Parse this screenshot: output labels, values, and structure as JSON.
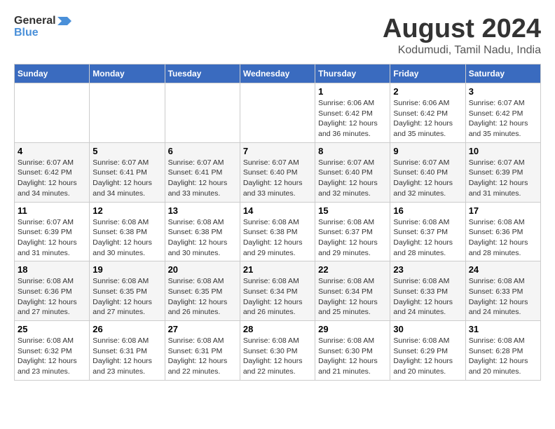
{
  "header": {
    "logo_general": "General",
    "logo_blue": "Blue",
    "title": "August 2024",
    "subtitle": "Kodumudi, Tamil Nadu, India"
  },
  "calendar": {
    "days_of_week": [
      "Sunday",
      "Monday",
      "Tuesday",
      "Wednesday",
      "Thursday",
      "Friday",
      "Saturday"
    ],
    "weeks": [
      [
        {
          "day": "",
          "info": ""
        },
        {
          "day": "",
          "info": ""
        },
        {
          "day": "",
          "info": ""
        },
        {
          "day": "",
          "info": ""
        },
        {
          "day": "1",
          "info": "Sunrise: 6:06 AM\nSunset: 6:42 PM\nDaylight: 12 hours\nand 36 minutes."
        },
        {
          "day": "2",
          "info": "Sunrise: 6:06 AM\nSunset: 6:42 PM\nDaylight: 12 hours\nand 35 minutes."
        },
        {
          "day": "3",
          "info": "Sunrise: 6:07 AM\nSunset: 6:42 PM\nDaylight: 12 hours\nand 35 minutes."
        }
      ],
      [
        {
          "day": "4",
          "info": "Sunrise: 6:07 AM\nSunset: 6:42 PM\nDaylight: 12 hours\nand 34 minutes."
        },
        {
          "day": "5",
          "info": "Sunrise: 6:07 AM\nSunset: 6:41 PM\nDaylight: 12 hours\nand 34 minutes."
        },
        {
          "day": "6",
          "info": "Sunrise: 6:07 AM\nSunset: 6:41 PM\nDaylight: 12 hours\nand 33 minutes."
        },
        {
          "day": "7",
          "info": "Sunrise: 6:07 AM\nSunset: 6:40 PM\nDaylight: 12 hours\nand 33 minutes."
        },
        {
          "day": "8",
          "info": "Sunrise: 6:07 AM\nSunset: 6:40 PM\nDaylight: 12 hours\nand 32 minutes."
        },
        {
          "day": "9",
          "info": "Sunrise: 6:07 AM\nSunset: 6:40 PM\nDaylight: 12 hours\nand 32 minutes."
        },
        {
          "day": "10",
          "info": "Sunrise: 6:07 AM\nSunset: 6:39 PM\nDaylight: 12 hours\nand 31 minutes."
        }
      ],
      [
        {
          "day": "11",
          "info": "Sunrise: 6:07 AM\nSunset: 6:39 PM\nDaylight: 12 hours\nand 31 minutes."
        },
        {
          "day": "12",
          "info": "Sunrise: 6:08 AM\nSunset: 6:38 PM\nDaylight: 12 hours\nand 30 minutes."
        },
        {
          "day": "13",
          "info": "Sunrise: 6:08 AM\nSunset: 6:38 PM\nDaylight: 12 hours\nand 30 minutes."
        },
        {
          "day": "14",
          "info": "Sunrise: 6:08 AM\nSunset: 6:38 PM\nDaylight: 12 hours\nand 29 minutes."
        },
        {
          "day": "15",
          "info": "Sunrise: 6:08 AM\nSunset: 6:37 PM\nDaylight: 12 hours\nand 29 minutes."
        },
        {
          "day": "16",
          "info": "Sunrise: 6:08 AM\nSunset: 6:37 PM\nDaylight: 12 hours\nand 28 minutes."
        },
        {
          "day": "17",
          "info": "Sunrise: 6:08 AM\nSunset: 6:36 PM\nDaylight: 12 hours\nand 28 minutes."
        }
      ],
      [
        {
          "day": "18",
          "info": "Sunrise: 6:08 AM\nSunset: 6:36 PM\nDaylight: 12 hours\nand 27 minutes."
        },
        {
          "day": "19",
          "info": "Sunrise: 6:08 AM\nSunset: 6:35 PM\nDaylight: 12 hours\nand 27 minutes."
        },
        {
          "day": "20",
          "info": "Sunrise: 6:08 AM\nSunset: 6:35 PM\nDaylight: 12 hours\nand 26 minutes."
        },
        {
          "day": "21",
          "info": "Sunrise: 6:08 AM\nSunset: 6:34 PM\nDaylight: 12 hours\nand 26 minutes."
        },
        {
          "day": "22",
          "info": "Sunrise: 6:08 AM\nSunset: 6:34 PM\nDaylight: 12 hours\nand 25 minutes."
        },
        {
          "day": "23",
          "info": "Sunrise: 6:08 AM\nSunset: 6:33 PM\nDaylight: 12 hours\nand 24 minutes."
        },
        {
          "day": "24",
          "info": "Sunrise: 6:08 AM\nSunset: 6:33 PM\nDaylight: 12 hours\nand 24 minutes."
        }
      ],
      [
        {
          "day": "25",
          "info": "Sunrise: 6:08 AM\nSunset: 6:32 PM\nDaylight: 12 hours\nand 23 minutes."
        },
        {
          "day": "26",
          "info": "Sunrise: 6:08 AM\nSunset: 6:31 PM\nDaylight: 12 hours\nand 23 minutes."
        },
        {
          "day": "27",
          "info": "Sunrise: 6:08 AM\nSunset: 6:31 PM\nDaylight: 12 hours\nand 22 minutes."
        },
        {
          "day": "28",
          "info": "Sunrise: 6:08 AM\nSunset: 6:30 PM\nDaylight: 12 hours\nand 22 minutes."
        },
        {
          "day": "29",
          "info": "Sunrise: 6:08 AM\nSunset: 6:30 PM\nDaylight: 12 hours\nand 21 minutes."
        },
        {
          "day": "30",
          "info": "Sunrise: 6:08 AM\nSunset: 6:29 PM\nDaylight: 12 hours\nand 20 minutes."
        },
        {
          "day": "31",
          "info": "Sunrise: 6:08 AM\nSunset: 6:28 PM\nDaylight: 12 hours\nand 20 minutes."
        }
      ]
    ]
  }
}
